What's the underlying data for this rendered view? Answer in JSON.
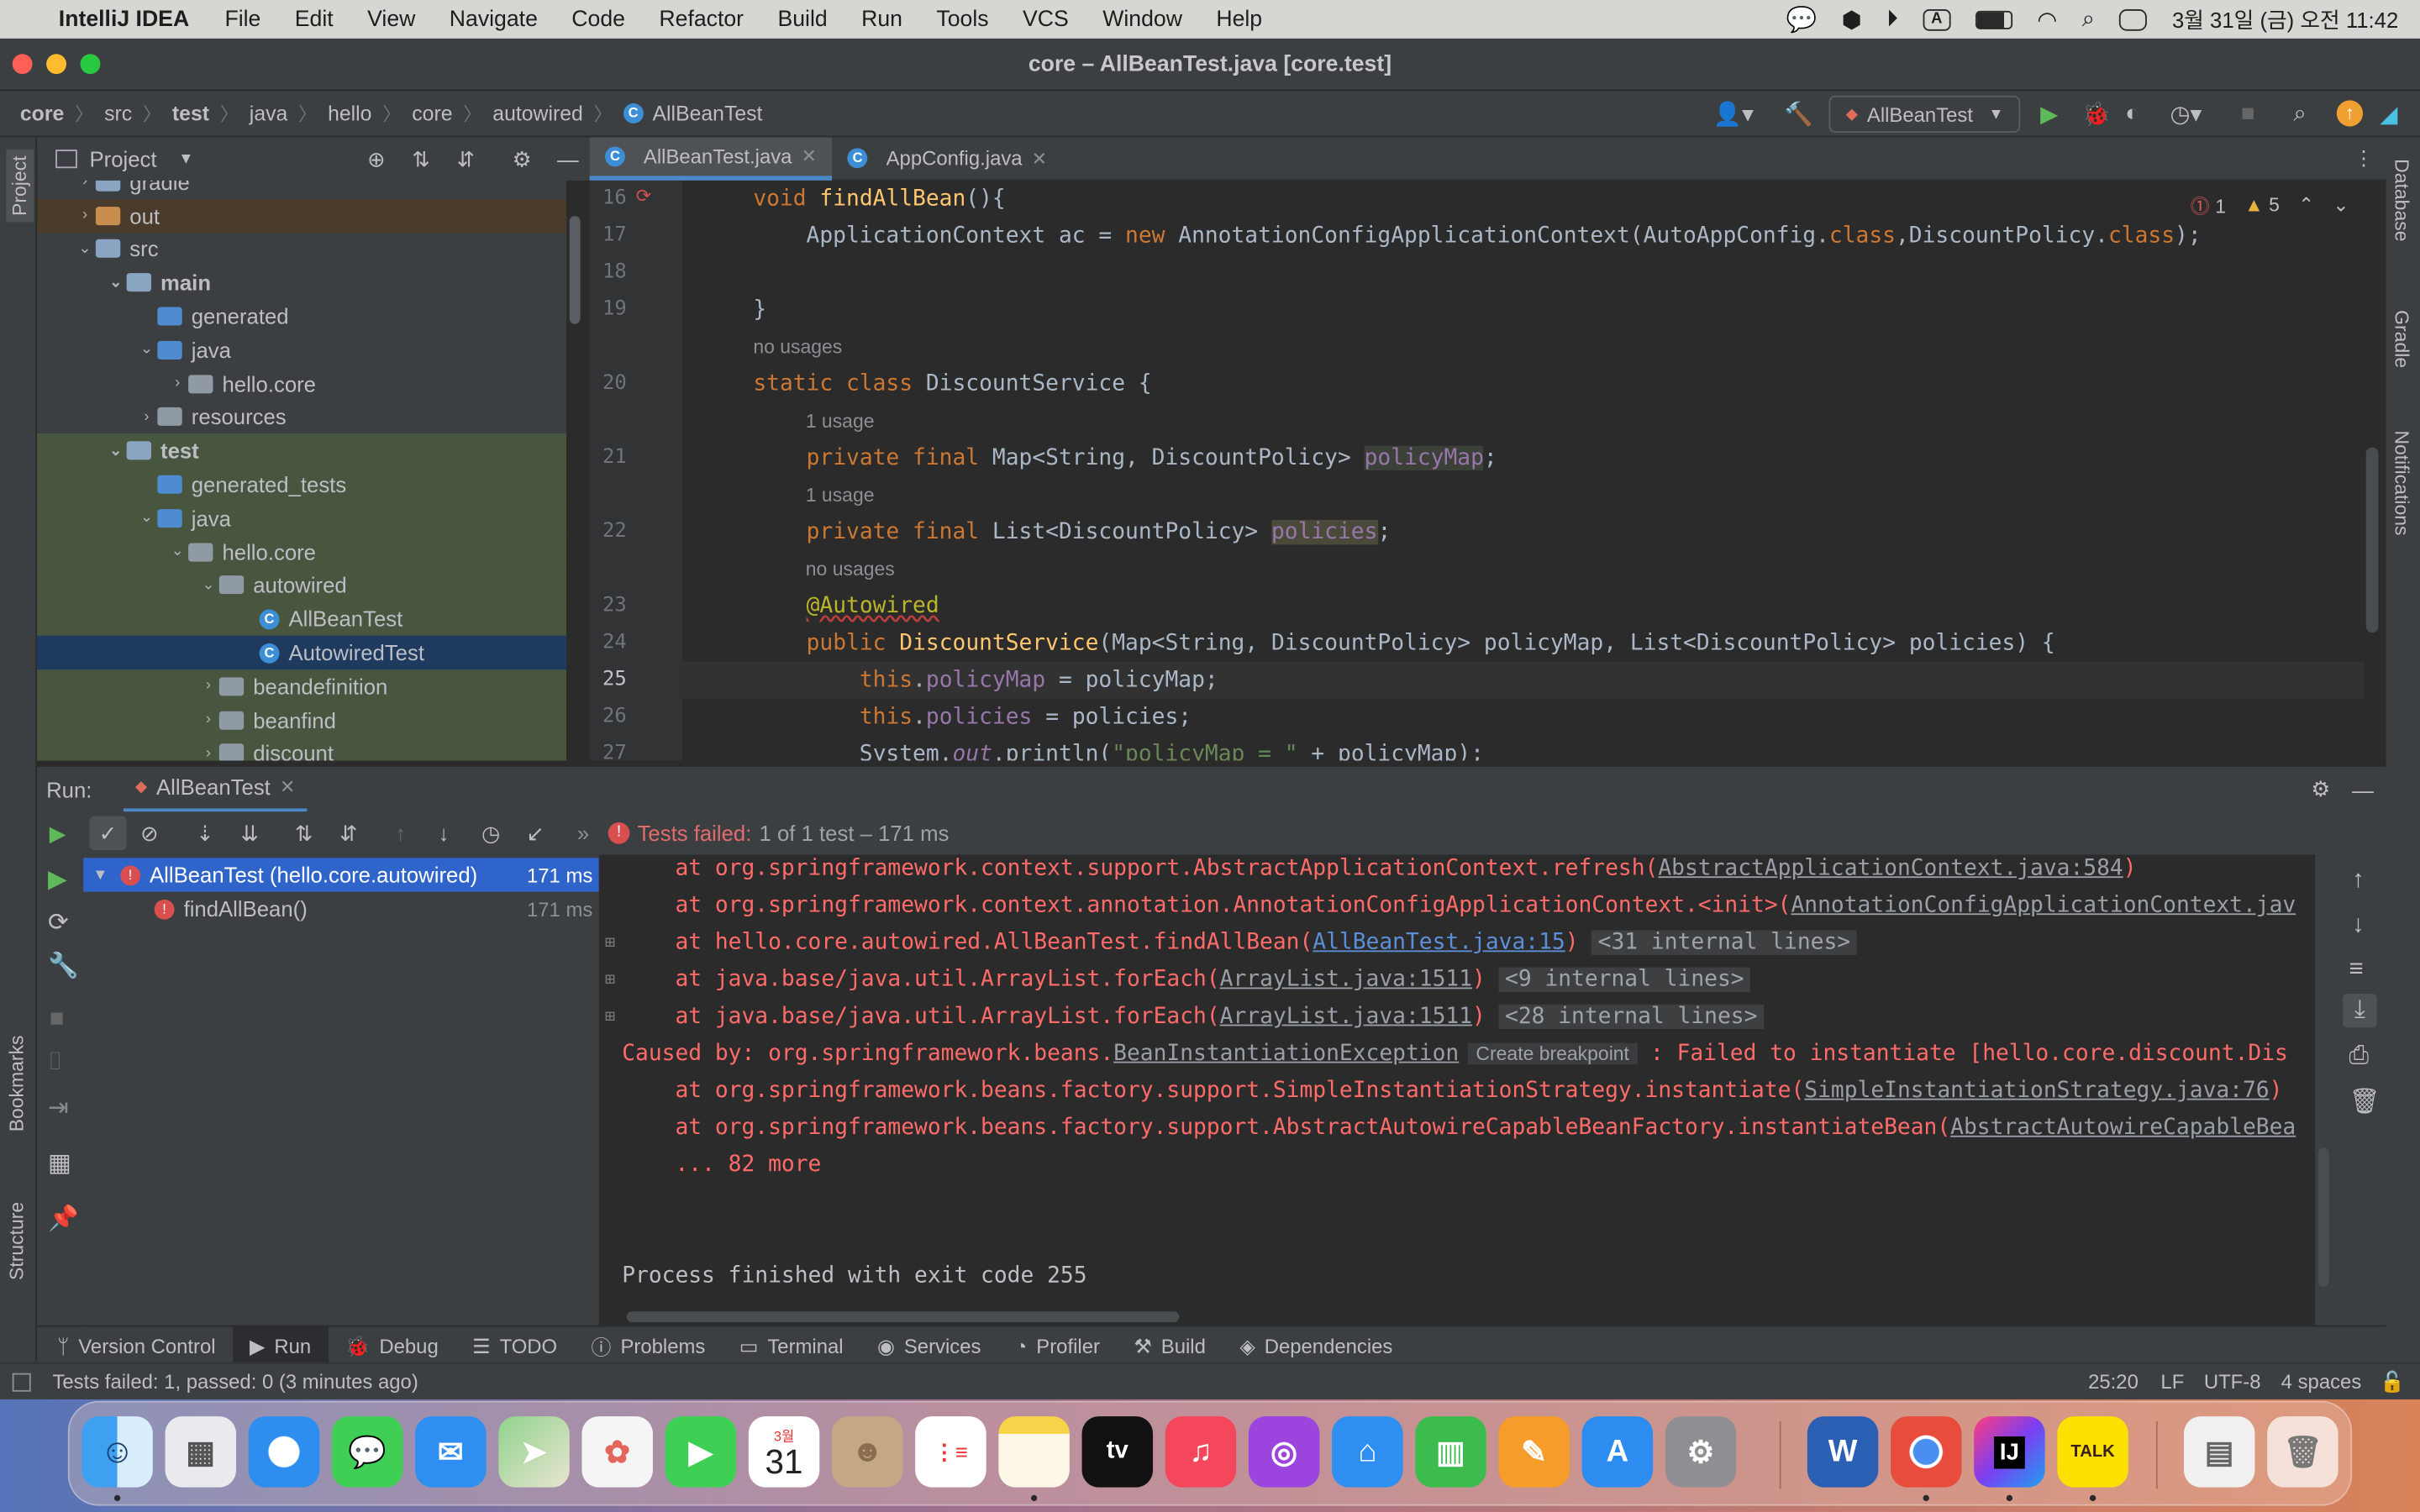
{
  "menubar": {
    "app_name": "IntelliJ IDEA",
    "items": [
      "File",
      "Edit",
      "View",
      "Navigate",
      "Code",
      "Refactor",
      "Build",
      "Run",
      "Tools",
      "VCS",
      "Window",
      "Help"
    ],
    "input_source": "A",
    "clock": "3월 31일 (금) 오전 11:42"
  },
  "window": {
    "title": "core – AllBeanTest.java [core.test]"
  },
  "breadcrumbs": [
    "core",
    "src",
    "test",
    "java",
    "hello",
    "core",
    "autowired",
    "AllBeanTest"
  ],
  "run_config": {
    "label": "AllBeanTest"
  },
  "project_panel": {
    "title": "Project",
    "tree": [
      {
        "label": "gradle"
      },
      {
        "label": "out"
      },
      {
        "label": "src"
      },
      {
        "label": "main"
      },
      {
        "label": "generated"
      },
      {
        "label": "java"
      },
      {
        "label": "hello.core"
      },
      {
        "label": "resources"
      },
      {
        "label": "test"
      },
      {
        "label": "generated_tests"
      },
      {
        "label": "java"
      },
      {
        "label": "hello.core"
      },
      {
        "label": "autowired"
      },
      {
        "label": "AllBeanTest"
      },
      {
        "label": "AutowiredTest"
      },
      {
        "label": "beandefinition"
      },
      {
        "label": "beanfind"
      },
      {
        "label": "discount"
      }
    ]
  },
  "editor": {
    "tabs": [
      {
        "label": "AllBeanTest.java"
      },
      {
        "label": "AppConfig.java"
      }
    ],
    "inspections": {
      "errors": "1",
      "warnings": "5"
    },
    "line_numbers": [
      "16",
      "17",
      "18",
      "19",
      "20",
      "21",
      "22",
      "23",
      "24",
      "25",
      "26",
      "27"
    ],
    "hints": {
      "h20": "no usages",
      "h21": "1 usage",
      "h22": "1 usage",
      "h23": "no usages"
    }
  },
  "run_panel": {
    "label": "Run:",
    "tab": "AllBeanTest",
    "status_prefix": "Tests failed:",
    "status_rest": "1 of 1 test – 171 ms",
    "tests": [
      {
        "name": "AllBeanTest (hello.core.autowired)",
        "time": "171 ms"
      },
      {
        "name": "findAllBean()",
        "time": "171 ms"
      }
    ],
    "console": {
      "l1a": "    at org.springframework.context.support.AbstractApplicationContext.refresh(",
      "l1b": "AbstractApplicationContext.java:584",
      "l1c": ")",
      "l2a": "    at org.springframework.context.annotation.AnnotationConfigApplicationContext.<init>(",
      "l2b": "AnnotationConfigApplicationContext.jav",
      "l3a": "    at hello.core.autowired.AllBeanTest.findAllBean(",
      "l3b": "AllBeanTest.java:15",
      "l3c": ") ",
      "l3d": "<31 internal lines>",
      "l4a": "    at java.base/java.util.ArrayList.forEach(",
      "l4b": "ArrayList.java:1511",
      "l4c": ") ",
      "l4d": "<9 internal lines>",
      "l5a": "    at java.base/java.util.ArrayList.forEach(",
      "l5b": "ArrayList.java:1511",
      "l5c": ") ",
      "l5d": "<28 internal lines>",
      "l6a": "Caused by: org.springframework.beans.",
      "l6b": "BeanInstantiationException",
      "l6c": "Create breakpoint",
      "l6d": " : Failed to instantiate [hello.core.discount.Dis",
      "l7a": "    at org.springframework.beans.factory.support.SimpleInstantiationStrategy.instantiate(",
      "l7b": "SimpleInstantiationStrategy.java:76",
      "l7c": ")",
      "l8a": "    at org.springframework.beans.factory.support.AbstractAutowireCapableBeanFactory.instantiateBean(",
      "l8b": "AbstractAutowireCapableBea",
      "l9": "    ... 82 more",
      "l10": "Process finished with exit code 255"
    }
  },
  "tool_tabs": [
    "Version Control",
    "Run",
    "Debug",
    "TODO",
    "Problems",
    "Terminal",
    "Services",
    "Profiler",
    "Build",
    "Dependencies"
  ],
  "side_tabs": {
    "left_top": "Project",
    "left_mid": "Bookmarks",
    "left_bottom": "Structure",
    "right": [
      "Database",
      "Gradle",
      "Notifications"
    ]
  },
  "status_bar": {
    "message": "Tests failed: 1, passed: 0 (3 minutes ago)",
    "position": "25:20",
    "line_sep": "LF",
    "encoding": "UTF-8",
    "indent": "4 spaces"
  },
  "dock": {
    "calendar_month": "3월",
    "calendar_day": "31",
    "word_label": "W",
    "ij_label": "IJ",
    "talk_label": "TALK",
    "tv_label": "tv"
  }
}
